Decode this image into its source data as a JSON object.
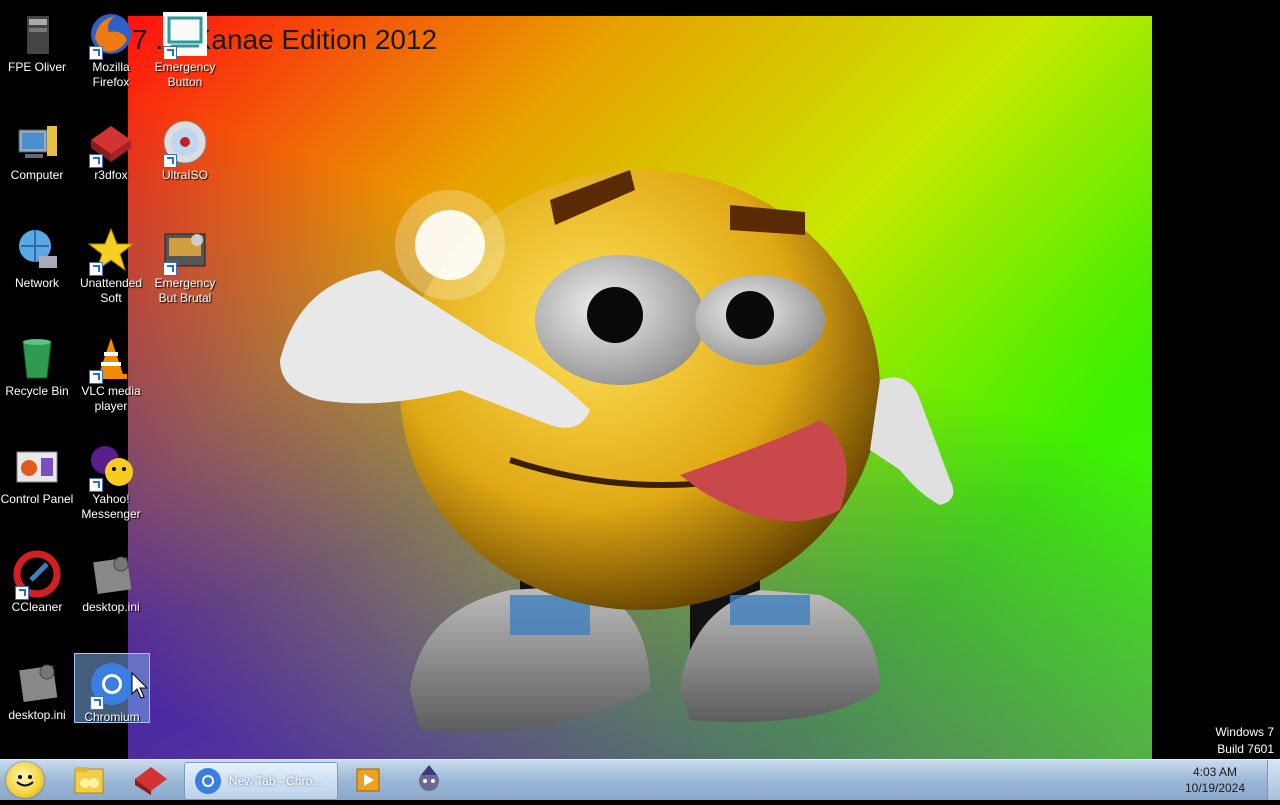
{
  "wallpaper": {
    "title": "7 ...sKanae Edition 2012"
  },
  "desktop_icons": [
    {
      "label": "FPE Oliver"
    },
    {
      "label": "Mozilla Firefox"
    },
    {
      "label": "Emergency Button"
    },
    {
      "label": "Computer"
    },
    {
      "label": "r3dfox"
    },
    {
      "label": "UltraISO"
    },
    {
      "label": "Network"
    },
    {
      "label": "Unattended Soft"
    },
    {
      "label": "Emergency But Brutal"
    },
    {
      "label": "Recycle Bin"
    },
    {
      "label": "VLC media player"
    },
    {
      "label": "Control Panel"
    },
    {
      "label": "Yahoo! Messenger"
    },
    {
      "label": "CCleaner"
    },
    {
      "label": "desktop.ini"
    },
    {
      "label": "desktop.ini"
    },
    {
      "label": "Chromium"
    }
  ],
  "watermark": {
    "line1": "Windows 7",
    "line2": "Build 7601"
  },
  "taskbar": {
    "active_window": "New Tab - Chro...",
    "clock_time": "4:03 AM",
    "clock_date": "10/19/2024"
  }
}
